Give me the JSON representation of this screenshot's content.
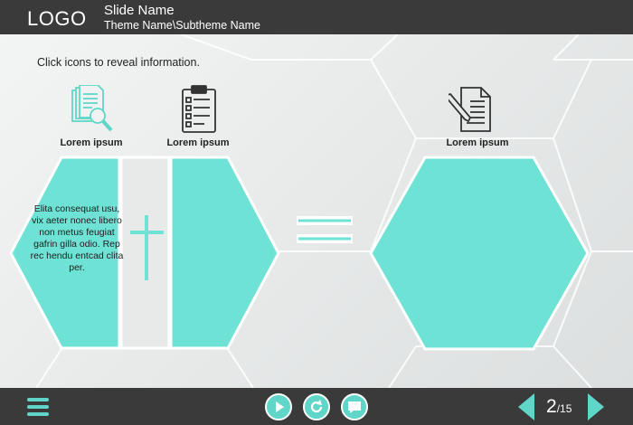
{
  "header": {
    "logo": "LOGO",
    "slide_name": "Slide Name",
    "theme_name": "Theme Name\\Subtheme Name"
  },
  "main": {
    "instruction": "Click icons to reveal information.",
    "icons": [
      {
        "name": "documents-search-icon",
        "label": "Lorem ipsum"
      },
      {
        "name": "clipboard-checklist-icon",
        "label": "Lorem ipsum"
      },
      {
        "name": "document-pencil-icon",
        "label": "Lorem ipsum"
      }
    ],
    "left_text": "Elita consequat usu, vix aeter nonec libero non metus feugiat gafrin gilla odio. Rep rec hendu entcad clita per."
  },
  "footer": {
    "page_current": "2",
    "page_total": "/15"
  },
  "colors": {
    "accent": "#5fd6c8",
    "hex_fill": "#6ee3d5",
    "bar": "#3a3a3a"
  }
}
